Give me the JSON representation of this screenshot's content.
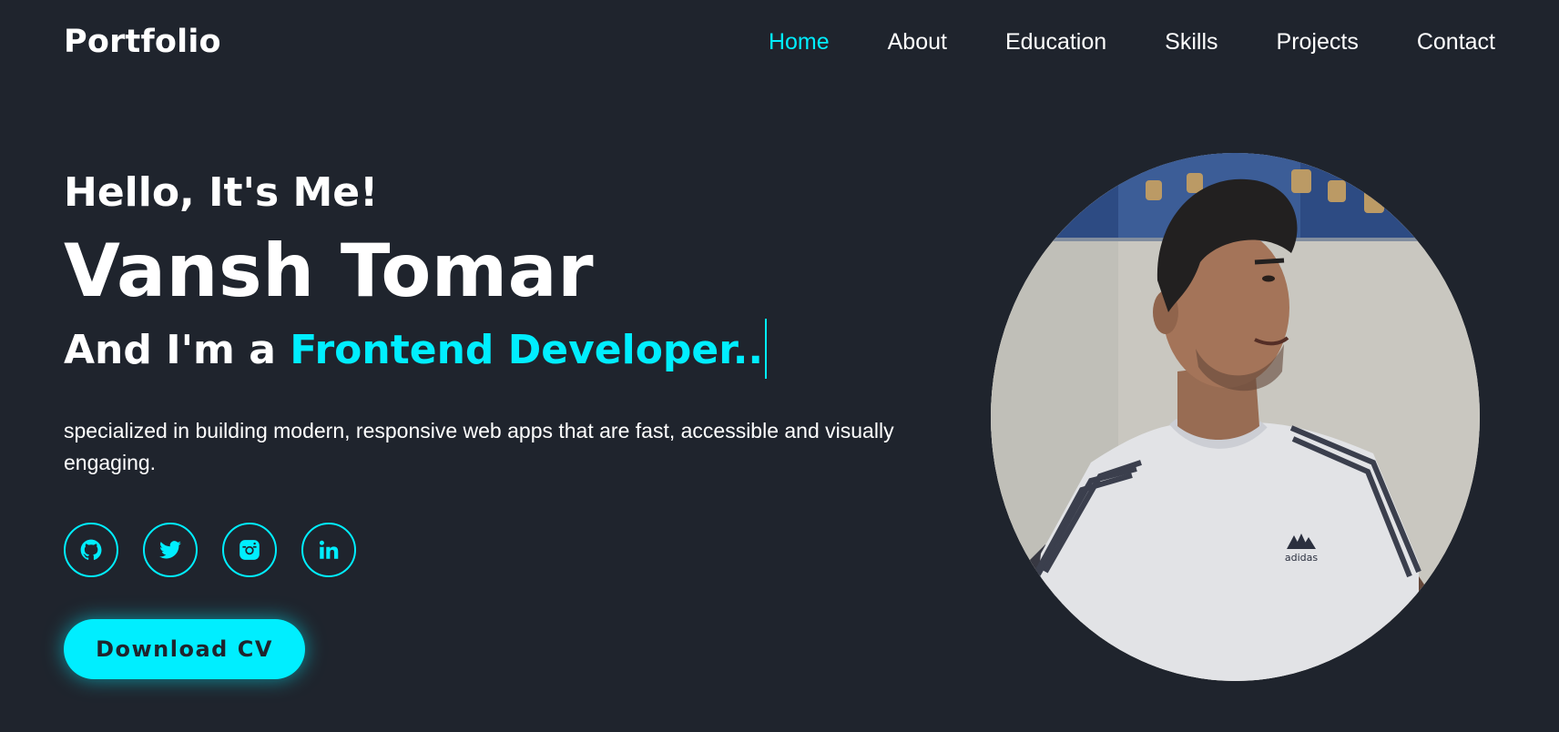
{
  "header": {
    "logo": "Portfolio",
    "nav": [
      {
        "label": "Home",
        "active": true
      },
      {
        "label": "About",
        "active": false
      },
      {
        "label": "Education",
        "active": false
      },
      {
        "label": "Skills",
        "active": false
      },
      {
        "label": "Projects",
        "active": false
      },
      {
        "label": "Contact",
        "active": false
      }
    ]
  },
  "hero": {
    "greeting": "Hello, It's Me!",
    "name": "Vansh Tomar",
    "role_prefix": "And I'm a ",
    "role": "Frontend Developer..",
    "description": "specialized in building modern, responsive web apps that are fast, accessible and visually engaging.",
    "socials": [
      {
        "icon": "github-icon"
      },
      {
        "icon": "twitter-icon"
      },
      {
        "icon": "instagram-icon"
      },
      {
        "icon": "linkedin-icon"
      }
    ],
    "cta_label": "Download CV",
    "photo_shirt_brand": "adidas"
  },
  "colors": {
    "background": "#1f242d",
    "accent": "#00eeff",
    "text": "#ffffff"
  }
}
